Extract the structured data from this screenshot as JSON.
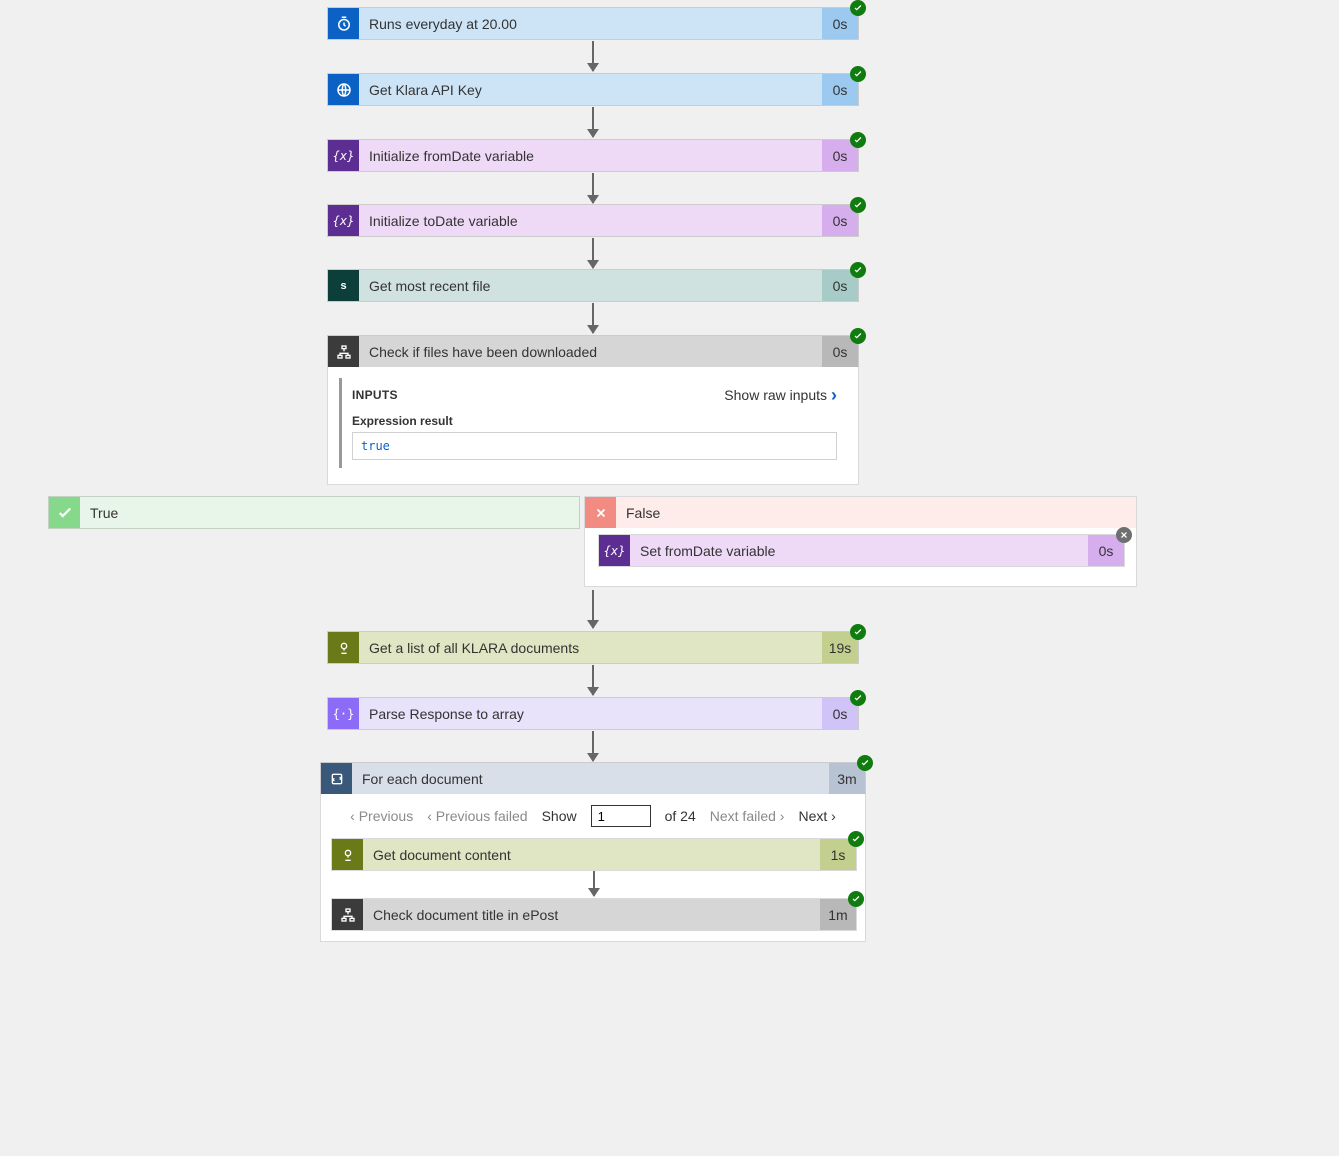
{
  "steps": {
    "trigger": {
      "title": "Runs everyday at 20.00",
      "dur": "0s"
    },
    "api_key": {
      "title": "Get Klara API Key",
      "dur": "0s"
    },
    "init_from": {
      "title": "Initialize fromDate variable",
      "dur": "0s"
    },
    "init_to": {
      "title": "Initialize toDate variable",
      "dur": "0s"
    },
    "recent": {
      "title": "Get most recent file",
      "dur": "0s"
    },
    "check": {
      "title": "Check if files have been downloaded",
      "dur": "0s"
    },
    "set_from": {
      "title": "Set fromDate variable",
      "dur": "0s"
    },
    "list_docs": {
      "title": "Get a list of all KLARA documents",
      "dur": "19s"
    },
    "parse": {
      "title": "Parse Response to array",
      "dur": "0s"
    },
    "foreach": {
      "title": "For each document",
      "dur": "3m"
    },
    "get_doc": {
      "title": "Get document content",
      "dur": "1s"
    },
    "check_title": {
      "title": "Check document title in ePost",
      "dur": "1m"
    }
  },
  "condition": {
    "inputs_heading": "INPUTS",
    "show_raw": "Show raw inputs",
    "expr_label": "Expression result",
    "expr_value": "true",
    "true_label": "True",
    "false_label": "False"
  },
  "pager": {
    "previous": "Previous",
    "previous_failed": "Previous failed",
    "show": "Show",
    "value": "1",
    "of": "of 24",
    "next_failed": "Next failed",
    "next": "Next"
  }
}
